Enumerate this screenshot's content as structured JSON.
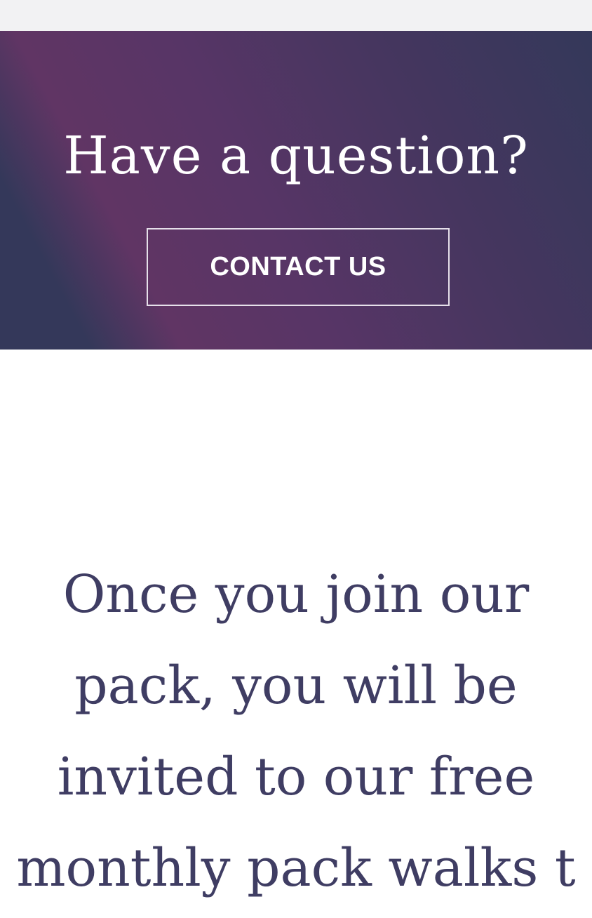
{
  "banner": {
    "title": "Have a question?",
    "button_label": "CONTACT US"
  },
  "body": {
    "lines": [
      "Once you join our",
      "pack, you will be",
      "invited to our free",
      "monthly pack walks t"
    ]
  },
  "colors": {
    "banner_gradient_start": "#603564",
    "banner_gradient_end": "#34385a",
    "body_text": "#3f3d63"
  }
}
